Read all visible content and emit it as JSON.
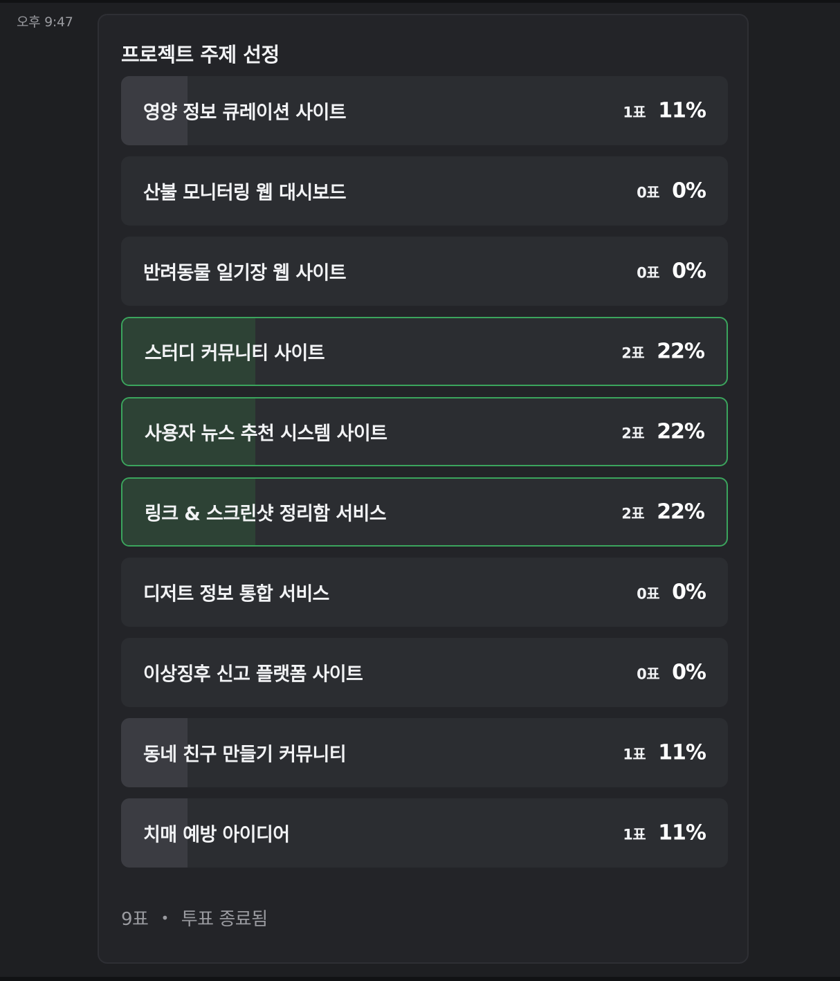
{
  "message": {
    "timestamp": "오후 9:47"
  },
  "poll": {
    "title": "프로젝트 주제 선정",
    "options": [
      {
        "label": "영양 정보 큐레이션 사이트",
        "votes": "1표",
        "percent": "11%",
        "fraction": 0.11,
        "winner": false
      },
      {
        "label": "산불 모니터링 웹 대시보드",
        "votes": "0표",
        "percent": "0%",
        "fraction": 0,
        "winner": false
      },
      {
        "label": "반려동물 일기장 웹 사이트",
        "votes": "0표",
        "percent": "0%",
        "fraction": 0,
        "winner": false
      },
      {
        "label": "스터디 커뮤니티 사이트",
        "votes": "2표",
        "percent": "22%",
        "fraction": 0.22,
        "winner": true
      },
      {
        "label": "사용자 뉴스 추천 시스템 사이트",
        "votes": "2표",
        "percent": "22%",
        "fraction": 0.22,
        "winner": true
      },
      {
        "label": "링크 & 스크린샷 정리함 서비스",
        "votes": "2표",
        "percent": "22%",
        "fraction": 0.22,
        "winner": true
      },
      {
        "label": "디저트 정보 통합 서비스",
        "votes": "0표",
        "percent": "0%",
        "fraction": 0,
        "winner": false
      },
      {
        "label": "이상징후 신고 플랫폼 사이트",
        "votes": "0표",
        "percent": "0%",
        "fraction": 0,
        "winner": false
      },
      {
        "label": "동네 친구 만들기 커뮤니티",
        "votes": "1표",
        "percent": "11%",
        "fraction": 0.11,
        "winner": false
      },
      {
        "label": "치매 예방 아이디어",
        "votes": "1표",
        "percent": "11%",
        "fraction": 0.11,
        "winner": false
      }
    ],
    "footer": {
      "total_votes": "9표",
      "separator": "•",
      "status": "투표 종료됨"
    }
  },
  "colors": {
    "background": "#1e1f22",
    "card": "#232428",
    "option": "#2b2d31",
    "fill": "#3b3c42",
    "winner_fill": "#2d4235",
    "winner_border": "#3ba55d",
    "muted_text": "#9a9ba0"
  }
}
